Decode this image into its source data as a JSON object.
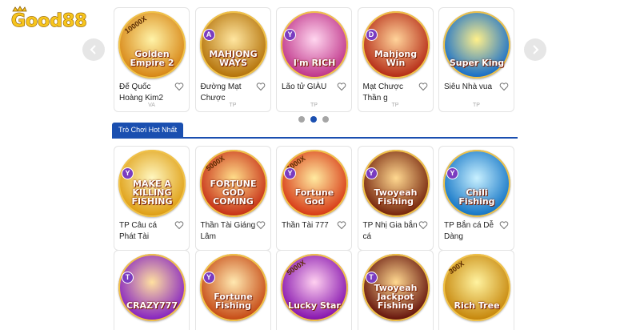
{
  "brand": {
    "logo_text": "Good88",
    "logo_icon": "crown-icon"
  },
  "carousel": {
    "prev_icon": "chevron-left-icon",
    "next_icon": "chevron-right-icon",
    "dots": [
      false,
      true,
      false
    ],
    "games": [
      {
        "name": "Đế Quốc Hoàng Kim2",
        "art_text": "Golden Empire 2",
        "top_text": "10000X",
        "badge": "",
        "provider": "VA",
        "colors": [
          "#fff3a8",
          "#d98a1a"
        ]
      },
      {
        "name": "Đường Mạt Chược",
        "art_text": "MAHJONG WAYS",
        "top_text": "",
        "badge": "A",
        "provider": "TP",
        "colors": [
          "#ffe6a0",
          "#b7770f"
        ]
      },
      {
        "name": "Lão tử GIÀU",
        "art_text": "I'm RICH",
        "top_text": "",
        "badge": "Y",
        "provider": "TP",
        "colors": [
          "#ffd6ef",
          "#c23b8e"
        ]
      },
      {
        "name": "Mạt Chược Thần g",
        "art_text": "Mahjong Win",
        "top_text": "",
        "badge": "D",
        "provider": "TP",
        "colors": [
          "#ffd39a",
          "#b8321b"
        ]
      },
      {
        "name": "Siêu Nhà vua",
        "art_text": "Super King",
        "top_text": "",
        "badge": "",
        "provider": "TP",
        "colors": [
          "#fff08a",
          "#1e73c8"
        ]
      }
    ]
  },
  "hot_section": {
    "title": "Trò Chơi Hot Nhất",
    "games": [
      {
        "name": "TP Câu cá Phát Tài",
        "art_text": "MAKE A KILLING FISHING",
        "top_text": "",
        "badge": "Y",
        "provider": "",
        "colors": [
          "#fff7c0",
          "#e0a21a"
        ]
      },
      {
        "name": "Thần Tài Giáng Lâm",
        "art_text": "FORTUNE GOD COMING",
        "top_text": "5000X",
        "badge": "",
        "provider": "",
        "colors": [
          "#ffdd8a",
          "#c9361a"
        ]
      },
      {
        "name": "Thần Tài 777",
        "art_text": "Fortune God",
        "top_text": "1000X",
        "badge": "Y",
        "provider": "",
        "colors": [
          "#ffeaa0",
          "#d9401a"
        ]
      },
      {
        "name": "TP Nhị Gia bắn cá",
        "art_text": "Twoyeah Fishing",
        "top_text": "",
        "badge": "Y",
        "provider": "",
        "colors": [
          "#ffd890",
          "#7a2a10"
        ]
      },
      {
        "name": "TP Bắn cá Dễ Dàng",
        "art_text": "Chili Fishing",
        "top_text": "",
        "badge": "Y",
        "provider": "",
        "colors": [
          "#c8f0ff",
          "#1a7ac8"
        ]
      }
    ]
  },
  "third_row": {
    "games": [
      {
        "art_text": "CRAZY777",
        "top_text": "",
        "badge": "T",
        "colors": [
          "#ffe0a0",
          "#8a2ac0"
        ]
      },
      {
        "art_text": "Fortune Fishing",
        "top_text": "",
        "badge": "Y",
        "colors": [
          "#ffe8b0",
          "#c8501a"
        ]
      },
      {
        "art_text": "Lucky Star",
        "top_text": "5000X",
        "badge": "",
        "colors": [
          "#ffd0f0",
          "#8a1ab0"
        ]
      },
      {
        "art_text": "Twoyeah Jackpot Fishing",
        "top_text": "",
        "badge": "T",
        "colors": [
          "#ffd890",
          "#6a1a10"
        ]
      },
      {
        "art_text": "Rich Tree",
        "top_text": "300X",
        "badge": "",
        "colors": [
          "#fff3a0",
          "#c88a10"
        ]
      }
    ]
  },
  "heart_icon": "heart-outline-icon"
}
